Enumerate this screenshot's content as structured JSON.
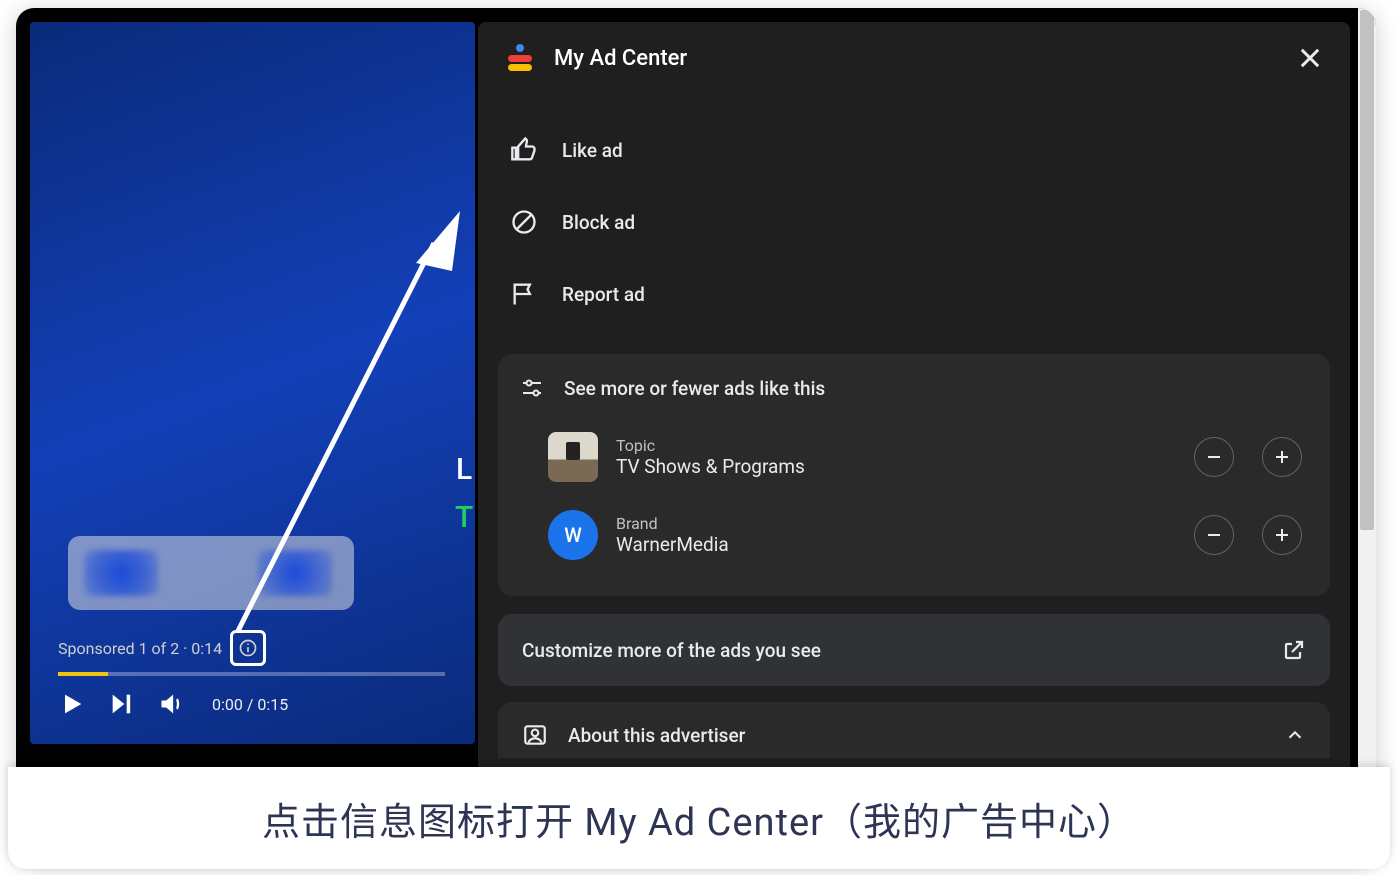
{
  "video": {
    "sponsored_label": "Sponsored 1 of 2 · 0:14",
    "time_current": "0:00",
    "time_total": "0:15",
    "overlay_letter": "L",
    "overlay_green": "T"
  },
  "panel": {
    "title": "My Ad Center",
    "actions": [
      {
        "label": "Like ad"
      },
      {
        "label": "Block ad"
      },
      {
        "label": "Report ad"
      }
    ],
    "tune_title": "See more or fewer ads like this",
    "prefs": [
      {
        "kind": "Topic",
        "name": "TV Shows & Programs",
        "avatar_letter": ""
      },
      {
        "kind": "Brand",
        "name": "WarnerMedia",
        "avatar_letter": "W"
      }
    ],
    "customize_label": "Customize more of the ads you see",
    "about_label": "About this advertiser"
  },
  "caption": "点击信息图标打开 My Ad Center（我的广告中心）"
}
